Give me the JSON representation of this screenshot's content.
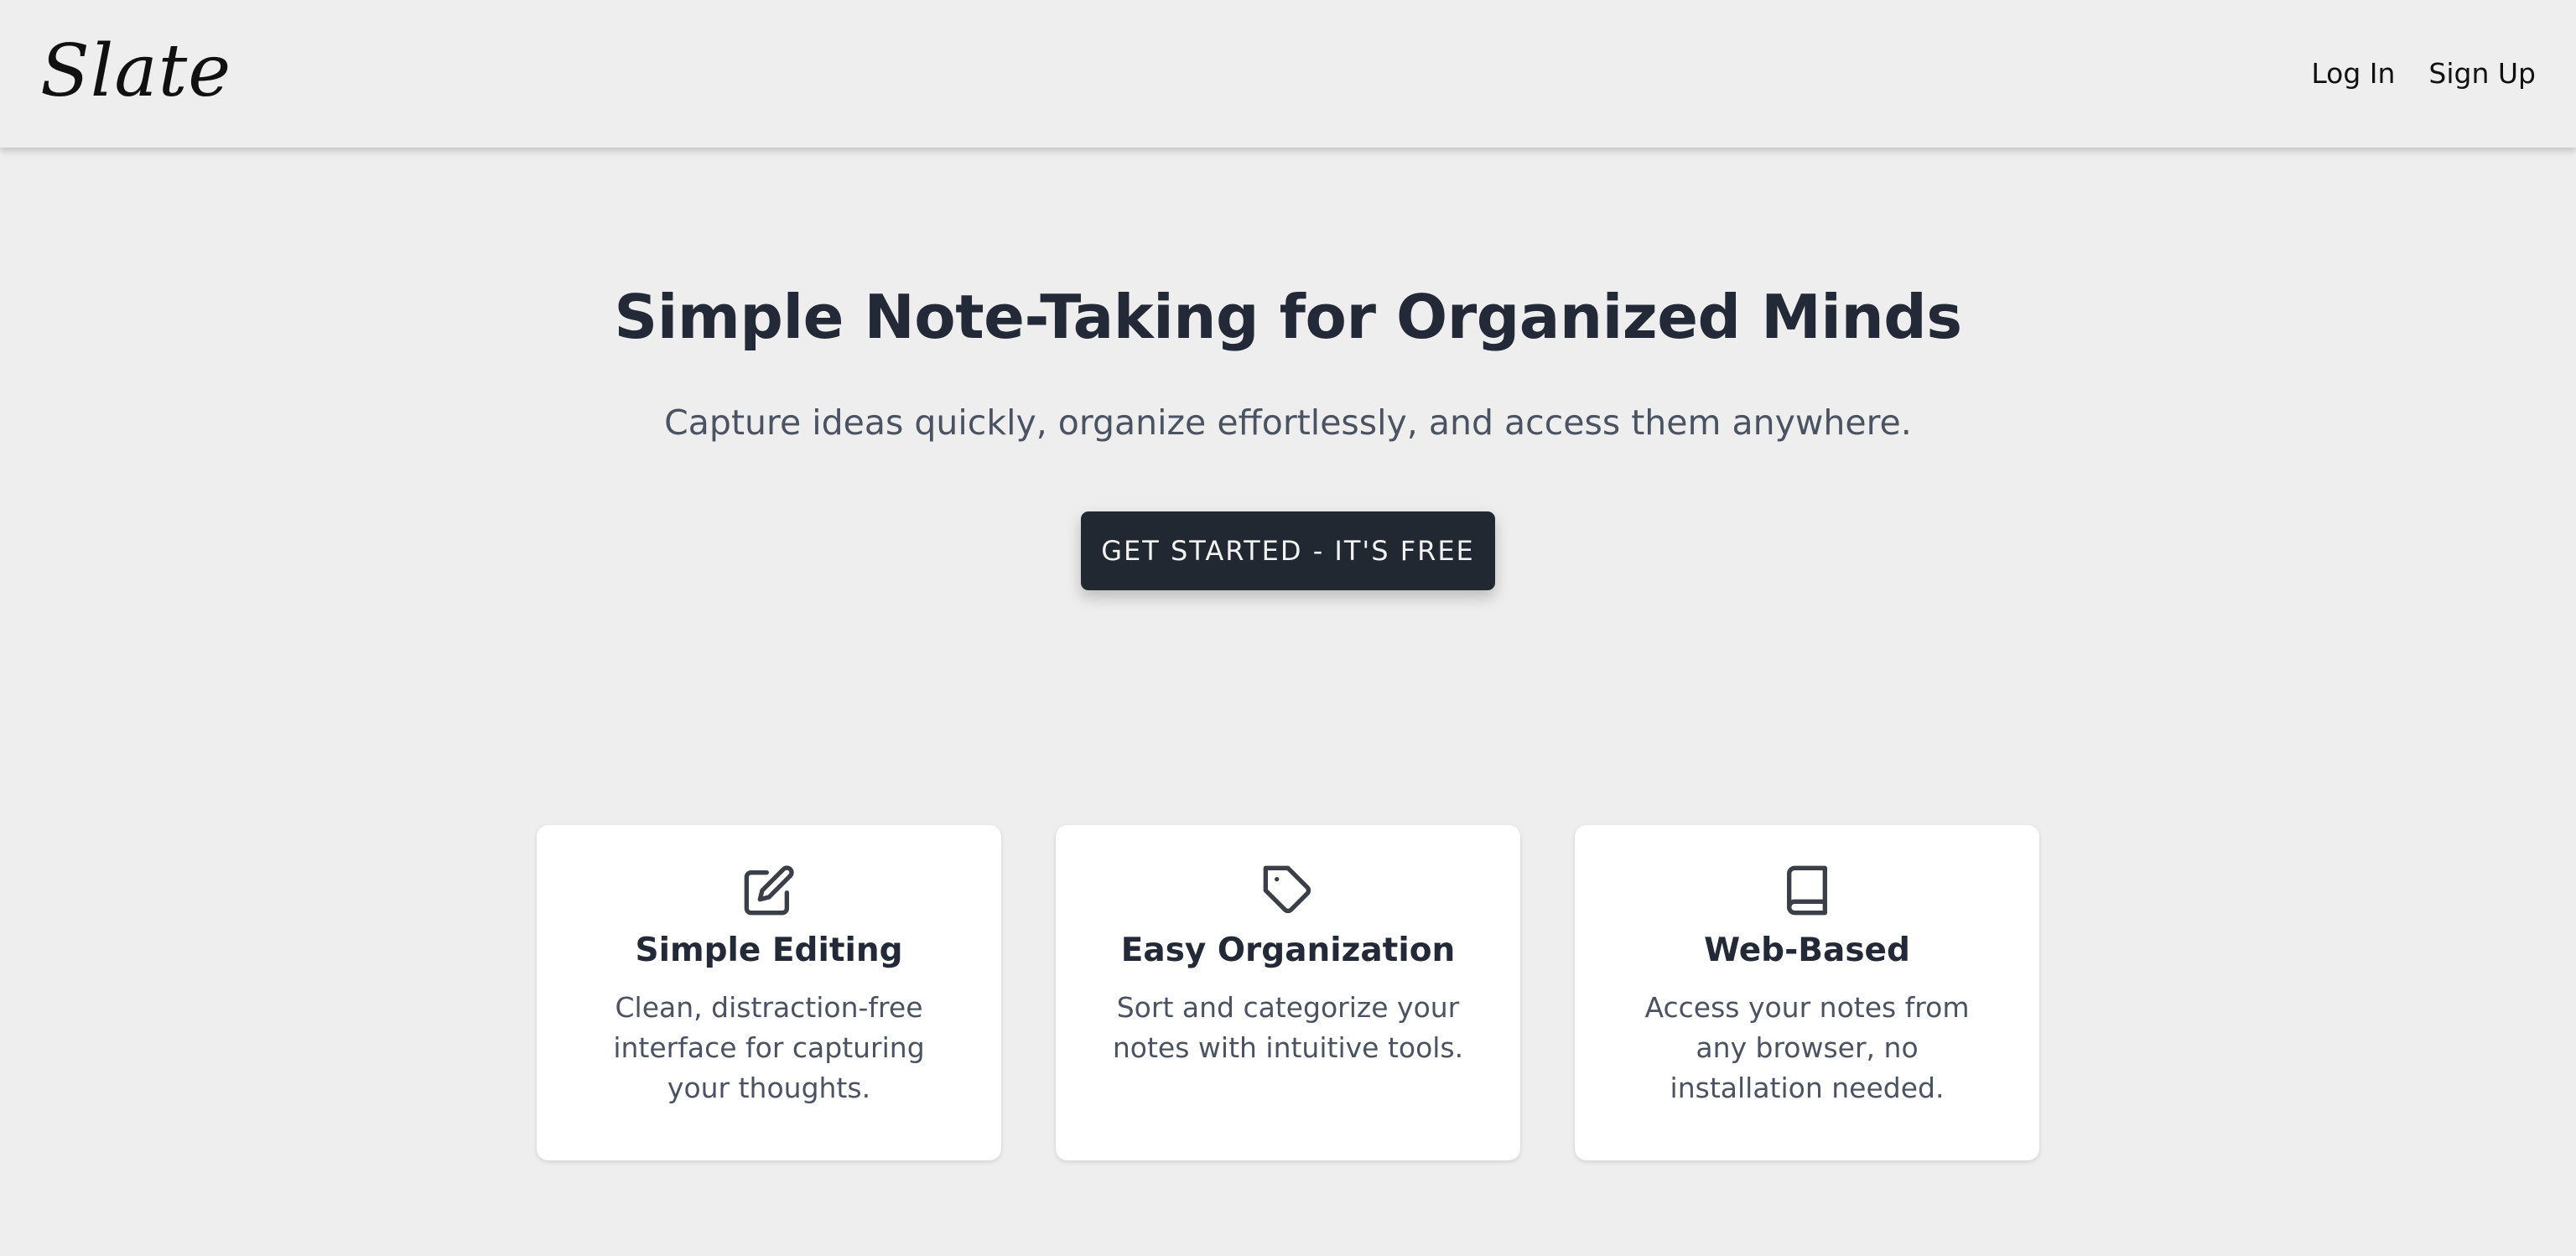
{
  "header": {
    "logo": "Slate",
    "nav": {
      "login_label": "Log In",
      "signup_label": "Sign Up"
    }
  },
  "hero": {
    "title": "Simple Note-Taking for Organized Minds",
    "subtitle": "Capture ideas quickly, organize effortlessly, and access them anywhere.",
    "cta_label": "GET STARTED - IT'S FREE"
  },
  "features": [
    {
      "icon": "edit-icon",
      "title": "Simple Editing",
      "description": "Clean, distraction-free interface for capturing your thoughts."
    },
    {
      "icon": "tag-icon",
      "title": "Easy Organization",
      "description": "Sort and categorize your notes with intuitive tools."
    },
    {
      "icon": "book-icon",
      "title": "Web-Based",
      "description": "Access your notes from any browser, no installation needed."
    }
  ],
  "colors": {
    "background": "#eeeeee",
    "primary_button": "#222832",
    "heading": "#232936",
    "body_text": "#4b5362",
    "card_background": "#ffffff"
  }
}
